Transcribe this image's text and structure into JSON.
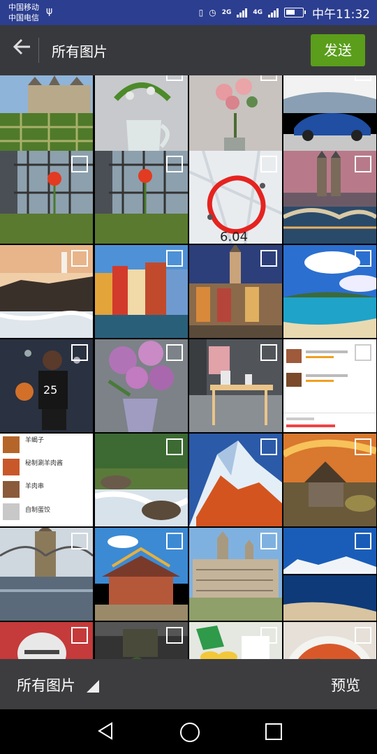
{
  "status_bar": {
    "carrier_1": "中国移动",
    "carrier_2": "中国电信",
    "usb_icon": "usb-icon",
    "network_2g": "2G",
    "network_4g": "4G",
    "time": "中午11:32",
    "battery_level": 0.6
  },
  "app_bar": {
    "back_icon": "arrow-left-icon",
    "title": "所有图片",
    "send_label": "发送",
    "send_color": "#5a9e1b"
  },
  "grid": {
    "tiles": [
      {
        "subject": "chateau-garden"
      },
      {
        "subject": "white-jug-flowers"
      },
      {
        "subject": "pink-roses-vase"
      },
      {
        "subject": "blue-sports-car"
      },
      {
        "subject": "red-flower-fence"
      },
      {
        "subject": "red-flower-fence-2"
      },
      {
        "subject": "running-track-map",
        "overlay_text": "6.04"
      },
      {
        "subject": "zurich-city"
      },
      {
        "subject": "lighthouse-cliffs"
      },
      {
        "subject": "colorful-houses-canal"
      },
      {
        "subject": "belfry-square-night"
      },
      {
        "subject": "seaside-bay"
      },
      {
        "subject": "basketball-player"
      },
      {
        "subject": "purple-roses-vase"
      },
      {
        "subject": "dining-room"
      },
      {
        "subject": "restaurant-list-screenshot"
      },
      {
        "subject": "food-menu-screenshot",
        "menu": [
          "羊蝎子",
          "秘制涮羊肉酱",
          "羊肉串",
          "自制蛋饺"
        ]
      },
      {
        "subject": "river-rapids"
      },
      {
        "subject": "matterhorn-sunset"
      },
      {
        "subject": "stone-church"
      },
      {
        "subject": "chain-bridge"
      },
      {
        "subject": "chinese-pavilion"
      },
      {
        "subject": "escorial-palace"
      },
      {
        "subject": "snowy-mountain-lake"
      },
      {
        "subject": "football-player"
      },
      {
        "subject": "dark-interior"
      },
      {
        "subject": "fruit-table"
      },
      {
        "subject": "soup-bowl"
      }
    ]
  },
  "bottom_bar": {
    "albums_label": "所有图片",
    "preview_label": "预览"
  },
  "nav_bar": {
    "back_icon": "triangle-back-icon",
    "home_icon": "circle-home-icon",
    "recent_icon": "square-recents-icon"
  }
}
